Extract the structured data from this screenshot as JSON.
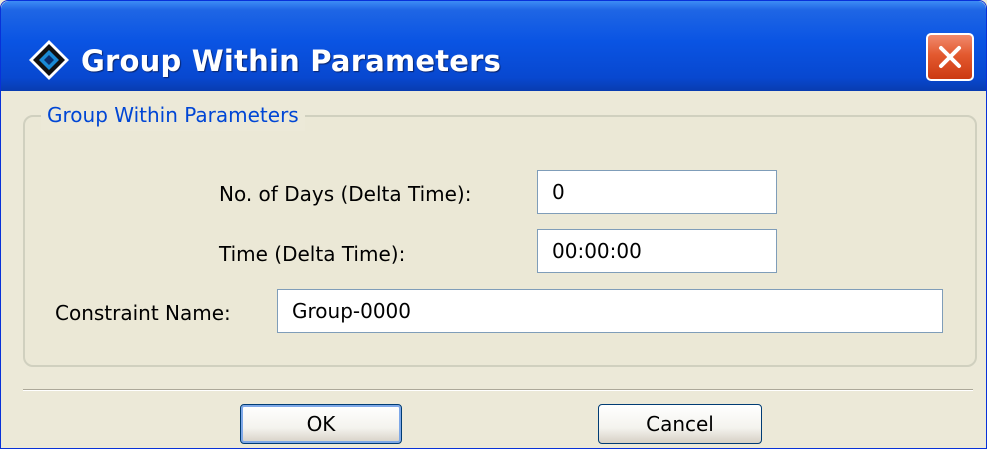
{
  "window": {
    "title": "Group Within Parameters",
    "colors": {
      "titlebar": "#0a54e3",
      "close": "#e3592f",
      "legend_text": "#0046d5",
      "background": "#ece9d8"
    }
  },
  "icons": {
    "app": "diamond-app-icon",
    "close": "close-icon"
  },
  "group": {
    "legend": "Group Within Parameters",
    "days_label": "No. of Days (Delta Time):",
    "days_value": "0",
    "time_label": "Time (Delta Time):",
    "time_value": "00:00:00",
    "name_label": "Constraint Name:",
    "name_value": "Group-0000"
  },
  "buttons": {
    "ok": "OK",
    "cancel": "Cancel"
  }
}
